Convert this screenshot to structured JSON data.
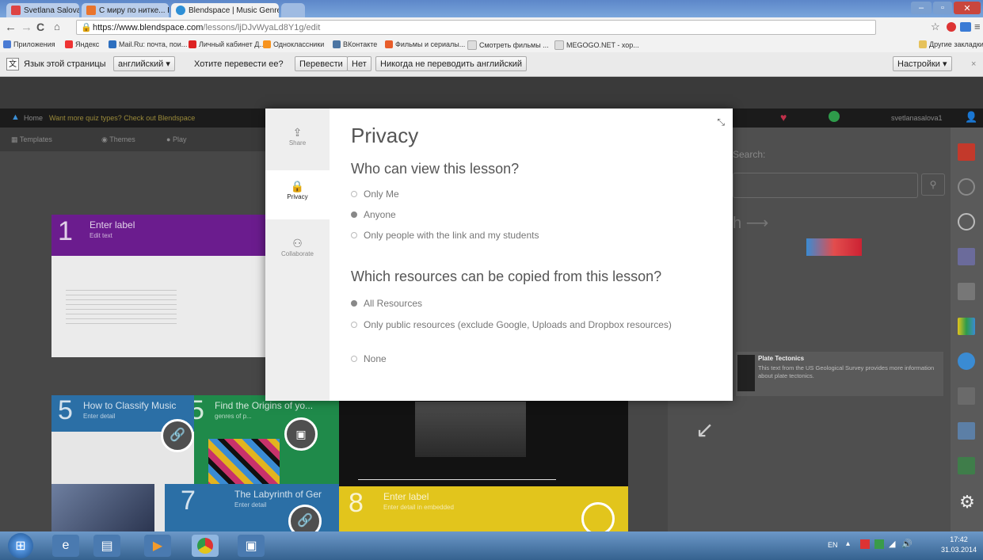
{
  "browser": {
    "tabs": [
      {
        "title": "Svetlana Salova - Google+",
        "fav": "#d44"
      },
      {
        "title": "С миру по нитке... Blendsp",
        "fav": "#e9742c"
      },
      {
        "title": "Blendspace | Music Genre",
        "fav": "#2d8fd6"
      }
    ],
    "url_host": "https://www.blendspace.com",
    "url_path": "/lessons/ljDJvWyaLd8Y1g/edit",
    "bookmarks": [
      {
        "label": "Приложения",
        "color": "#4a7bd4"
      },
      {
        "label": "Яндекс",
        "color": "#e33"
      },
      {
        "label": "Mail.Ru: почта, пои...",
        "color": "#2d6fbf"
      },
      {
        "label": "Личный кабинет Д...",
        "color": "#d22"
      },
      {
        "label": "Одноклассники",
        "color": "#f7931e"
      },
      {
        "label": "ВКонтакте",
        "color": "#4c75a3"
      },
      {
        "label": "Фильмы и сериалы...",
        "color": "#e85d2a"
      },
      {
        "label": "Смотреть фильмы ...",
        "color": "#ccc"
      },
      {
        "label": "MEGOGO.NET - хор...",
        "color": "#ccc"
      }
    ],
    "other_bookmarks": "Другие закладки"
  },
  "translate_bar": {
    "prompt": "Язык этой страницы",
    "language": "английский",
    "question": "Хотите перевести ее?",
    "translate_btn": "Перевести",
    "no_btn": "Нет",
    "never_btn": "Никогда не переводить английский",
    "settings_btn": "Настройки"
  },
  "app": {
    "nav_home": "Home",
    "nav_promo": "Want more quiz types? Check out Blendspace",
    "username": "svetlanasalova1",
    "toolbar": [
      "Templates",
      "Themes",
      "Play"
    ],
    "search_label": "Search:",
    "tiles": [
      {
        "num": "1",
        "title": "Enter label",
        "sub": "Edit text",
        "color": "#6b1c8e"
      },
      {
        "num": "5",
        "title": "How to Classify Music",
        "sub": "Enter detail",
        "color": "#2b6fa6"
      },
      {
        "num": "5",
        "title": "Find the Origins of yo...",
        "sub": "genres of p...",
        "color": "#1f8a4a"
      },
      {
        "num": "7",
        "title": "The Labyrinth of Ger",
        "sub": "Enter detail",
        "color": "#2b6fa6"
      },
      {
        "num": "8",
        "title": "Enter label",
        "sub": "Enter detail in embedded",
        "color": "#e2c51c"
      }
    ],
    "result_title": "Plate Tectonics",
    "result_desc": "This text from the US Geological Survey provides more information about plate tectonics."
  },
  "modal": {
    "side_tabs": [
      "Share",
      "Privacy",
      "Collaborate"
    ],
    "title": "Privacy",
    "q1": "Who can view this lesson?",
    "q1_options": [
      "Only Me",
      "Anyone",
      "Only people with the link and my students"
    ],
    "q2": "Which resources can be copied from this lesson?",
    "q2_options": [
      "All Resources",
      "Only public resources (exclude Google, Uploads and Dropbox resources)",
      "None"
    ]
  },
  "taskbar": {
    "lang": "EN",
    "time": "17:42",
    "date": "31.03.2014"
  }
}
